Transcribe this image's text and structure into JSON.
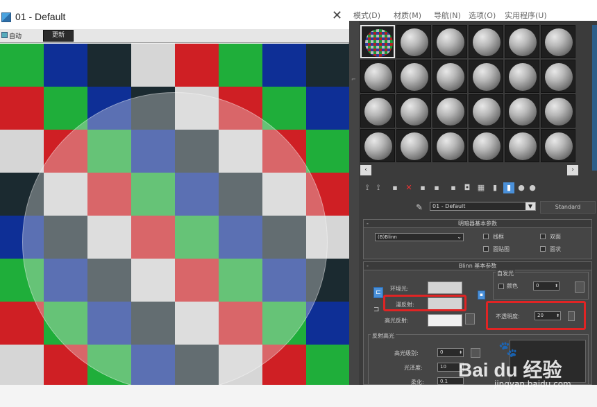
{
  "viewer": {
    "title": "01 - Default",
    "auto_label": "自动",
    "update_label": "更新",
    "checker_colors": [
      "#1fae3a",
      "#0e2f96",
      "#1b2a30",
      "#d6d6d6",
      "#cf1f24"
    ]
  },
  "editor": {
    "menu": [
      "模式(D)",
      "材质(M)",
      "导航(N)",
      "选项(O)",
      "实用程序(U)"
    ],
    "material_name": "01 - Default",
    "standard_label": "Standard",
    "shader_rollout": {
      "title": "明暗器基本参数",
      "shader": "(B)Blinn",
      "wire_label": "线框",
      "two_sided_label": "双面",
      "face_map_label": "面贴图",
      "faceted_label": "面状"
    },
    "blinn_rollout": {
      "title": "Blinn 基本参数",
      "self_illum_label": "自发光",
      "color_label": "颜色",
      "self_illum_value": "0",
      "ambient_label": "环境光:",
      "diffuse_label": "漫反射:",
      "specular_label": "高光反射:",
      "opacity_label": "不透明度:",
      "opacity_value": "20",
      "spec_group_label": "反射高光",
      "spec_level_label": "高光级别:",
      "spec_level_value": "0",
      "gloss_label": "光泽度:",
      "gloss_value": "10",
      "soften_label": "柔化:",
      "soften_value": "0.1"
    }
  },
  "watermark": {
    "main": "Bai du 经验",
    "sub": "jingyan.baidu.com"
  },
  "icons": [
    "app-icon",
    "close-icon",
    "eyedropper-icon",
    "lock-icon",
    "chevron-down-icon"
  ]
}
